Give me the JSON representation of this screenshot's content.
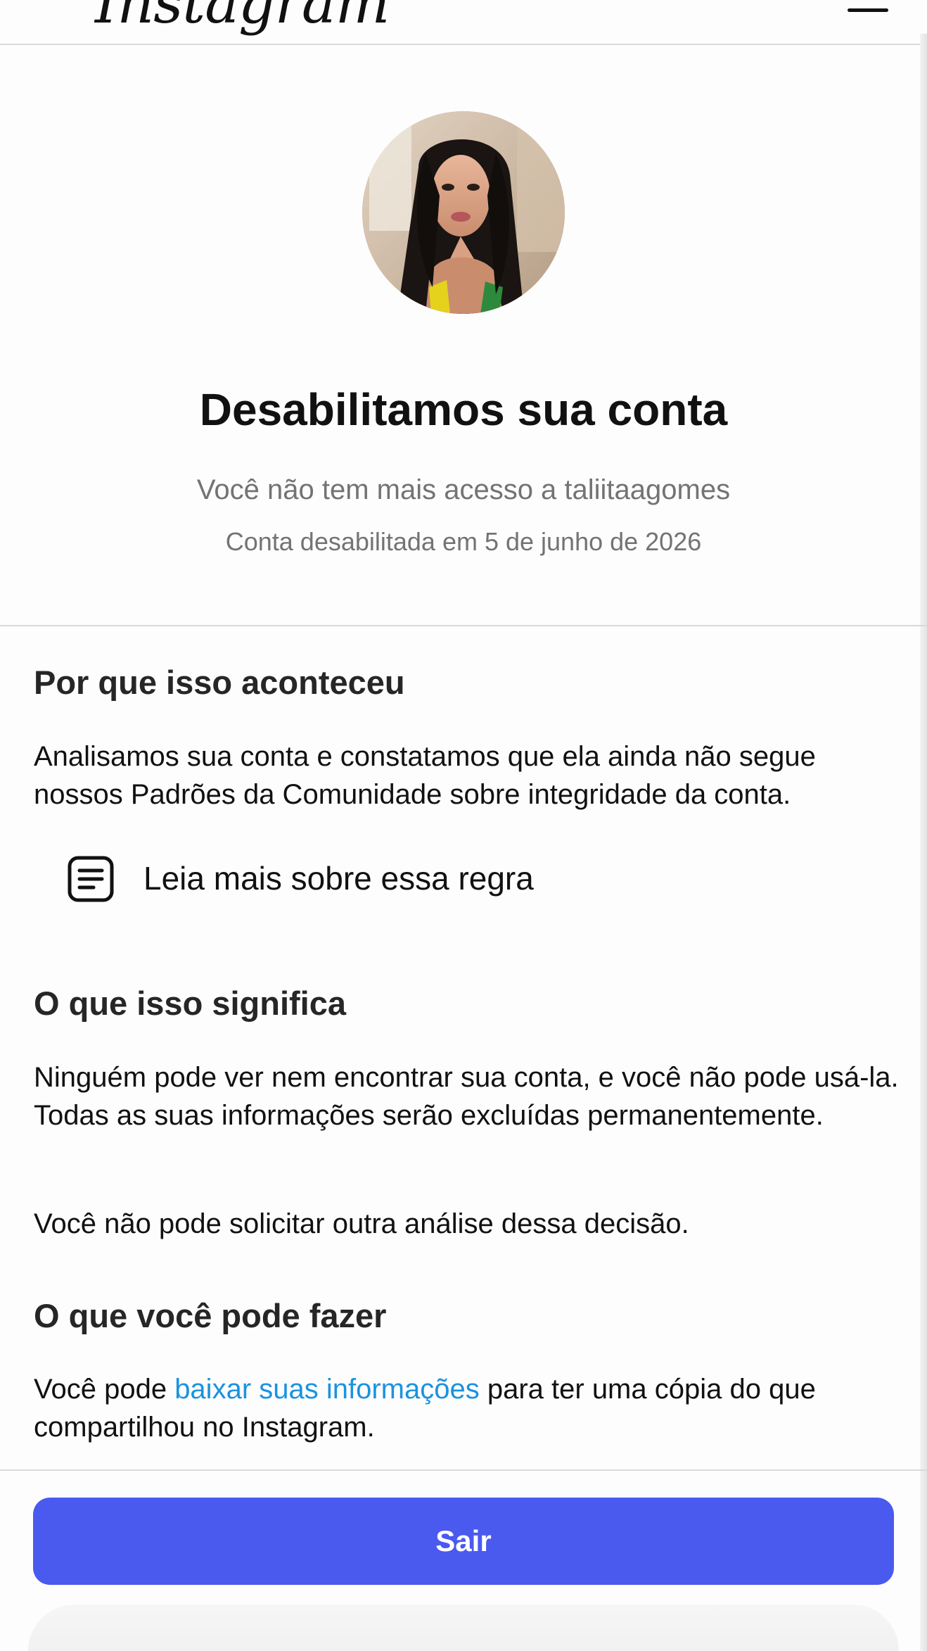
{
  "header": {
    "logo_text": "Instagram",
    "menu_icon": "hamburger-menu-icon"
  },
  "profile": {
    "avatar_icon": "profile-photo"
  },
  "status": {
    "title": "Desabilitamos sua conta",
    "subtitle": "Você não tem mais acesso a taliitaagomes",
    "disabled_date": "Conta desabilitada em 5 de junho de 2026"
  },
  "why": {
    "heading": "Por que isso aconteceu",
    "body": "Analisamos sua conta e constatamos que ela ainda não segue nossos Padrões da Comunidade sobre integridade da conta.",
    "rule_link_label": "Leia mais sobre essa regra",
    "rule_icon": "document-icon"
  },
  "meaning": {
    "heading": "O que isso significa",
    "body": "Ninguém pode ver nem encontrar sua conta, e você não pode usá-la. Todas as suas informações serão excluídas permanentemente.",
    "no_review": "Você não pode solicitar outra análise dessa decisão."
  },
  "actions": {
    "heading": "O que você pode fazer",
    "body_prefix": "Você pode ",
    "download_link": "baixar suas informações",
    "body_suffix": " para ter uma cópia do que compartilhou no Instagram."
  },
  "footer": {
    "exit_label": "Sair",
    "accent_color": "#4a5aef",
    "link_color": "#1a93e0"
  }
}
